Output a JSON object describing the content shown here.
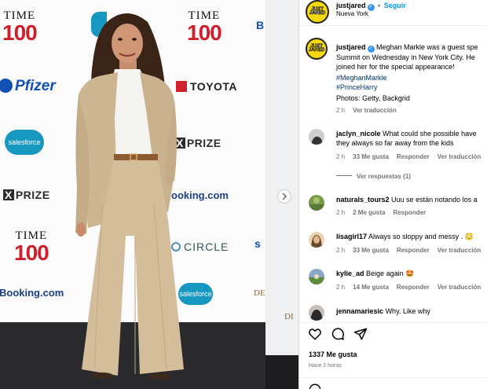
{
  "photo": {
    "logos": {
      "time_top": "TIME",
      "hundred": "100",
      "pfizer": "Pfizer",
      "salesforce": "salesforce",
      "toyota": "TOYOTA",
      "xprize": "PRIZE",
      "x": "X",
      "booking": "Booking.com",
      "booking_cut": "ooking.com",
      "circle": "CIRCLE",
      "s_cut": "s",
      "b_cut": "B",
      "di_cut": "DI",
      "de_cut": "DE"
    },
    "next_icon": "chevron-right-icon"
  },
  "header": {
    "avatar_text": "JUST JARED",
    "username": "justjared",
    "follow": "Seguir",
    "location": "Nueva York",
    "dot": "•"
  },
  "caption": {
    "username": "justjared",
    "text_line1": "Meghan Markle was a guest spe",
    "text_line2": "Summit on Wednesday in New York City. He",
    "text_line3": "joined her for the special appearance!",
    "tag1": "#MeghanMarkle",
    "tag2": "#PrinceHarry",
    "credit": "Photos: Getty, Backgrid",
    "time": "2 h",
    "translate": "Ver traducción"
  },
  "comments": [
    {
      "user": "jaclyn_nicole",
      "text": "What could she possible have",
      "text2": "they always so far away from the kids",
      "time": "2 h",
      "likes": "33 Me gusta",
      "reply": "Responder",
      "translate": "Ver traducción",
      "replies": "Ver respuestas (1)"
    },
    {
      "user": "naturals_tours2",
      "text": "Uuu se están notando los a",
      "time": "2 h",
      "likes": "2 Me gusta",
      "reply": "Responder"
    },
    {
      "user": "lisagirl17",
      "text": "Always so sloppy and messy .",
      "emoji": "😳",
      "time": "2 h",
      "likes": "33 Me gusta",
      "reply": "Responder",
      "translate": "Ver traducción"
    },
    {
      "user": "kylie_ad",
      "text": "Beige again",
      "emoji": "🤩",
      "time": "2 h",
      "likes": "14 Me gusta",
      "reply": "Responder",
      "translate": "Ver traducción"
    },
    {
      "user": "jennamariesic",
      "text": "Why. Like why"
    }
  ],
  "actions": {
    "like_icon": "heart-icon",
    "comment_icon": "comment-icon",
    "share_icon": "send-icon",
    "likes": "1337 Me gusta",
    "ago": "Hace 2 horas"
  },
  "colors": {
    "link_blue": "#0095f6",
    "tag_blue": "#00376b",
    "meta_gray": "#737373",
    "jj_yellow": "#f5d90a",
    "suit_beige": "#cdb692"
  }
}
